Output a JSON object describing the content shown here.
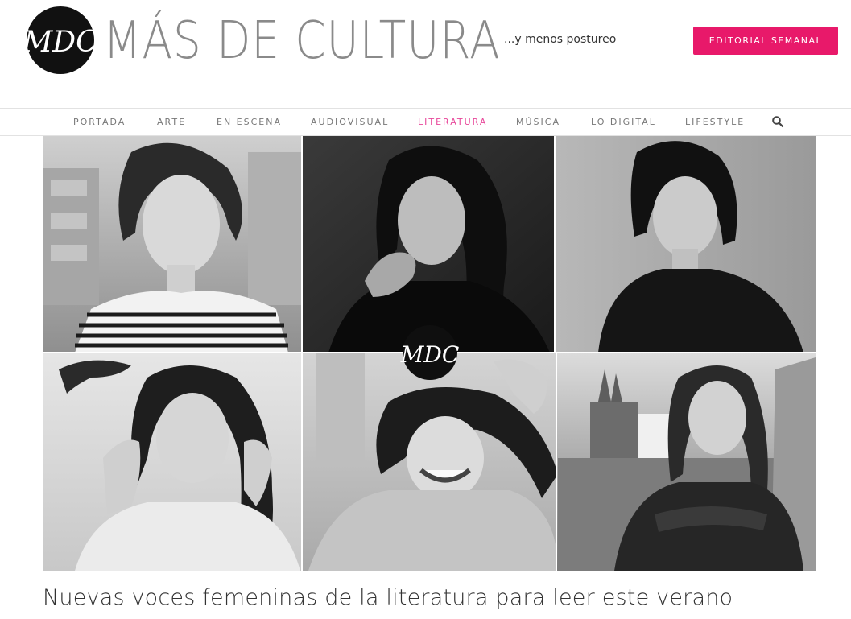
{
  "header": {
    "logo_mark": "MDC",
    "site_name": "MÁS DE CULTURA",
    "tagline": "...y menos postureo",
    "cta_label": "EDITORIAL SEMANAL"
  },
  "nav": {
    "items": [
      {
        "label": "PORTADA",
        "active": false
      },
      {
        "label": "ARTE",
        "active": false
      },
      {
        "label": "EN ESCENA",
        "active": false
      },
      {
        "label": "AUDIOVISUAL",
        "active": false
      },
      {
        "label": "LITERATURA",
        "active": true
      },
      {
        "label": "MÚSICA",
        "active": false
      },
      {
        "label": "LO DIGITAL",
        "active": false
      },
      {
        "label": "LIFESTYLE",
        "active": false
      }
    ],
    "search_icon": "search-icon"
  },
  "hero": {
    "watermark": "MDC"
  },
  "article": {
    "title": "Nuevas voces femeninas de la literatura para leer este verano"
  },
  "colors": {
    "accent": "#e8196a",
    "nav_active": "#e8479a",
    "nav_text": "#777777",
    "logo_text": "#8a8a8a"
  }
}
